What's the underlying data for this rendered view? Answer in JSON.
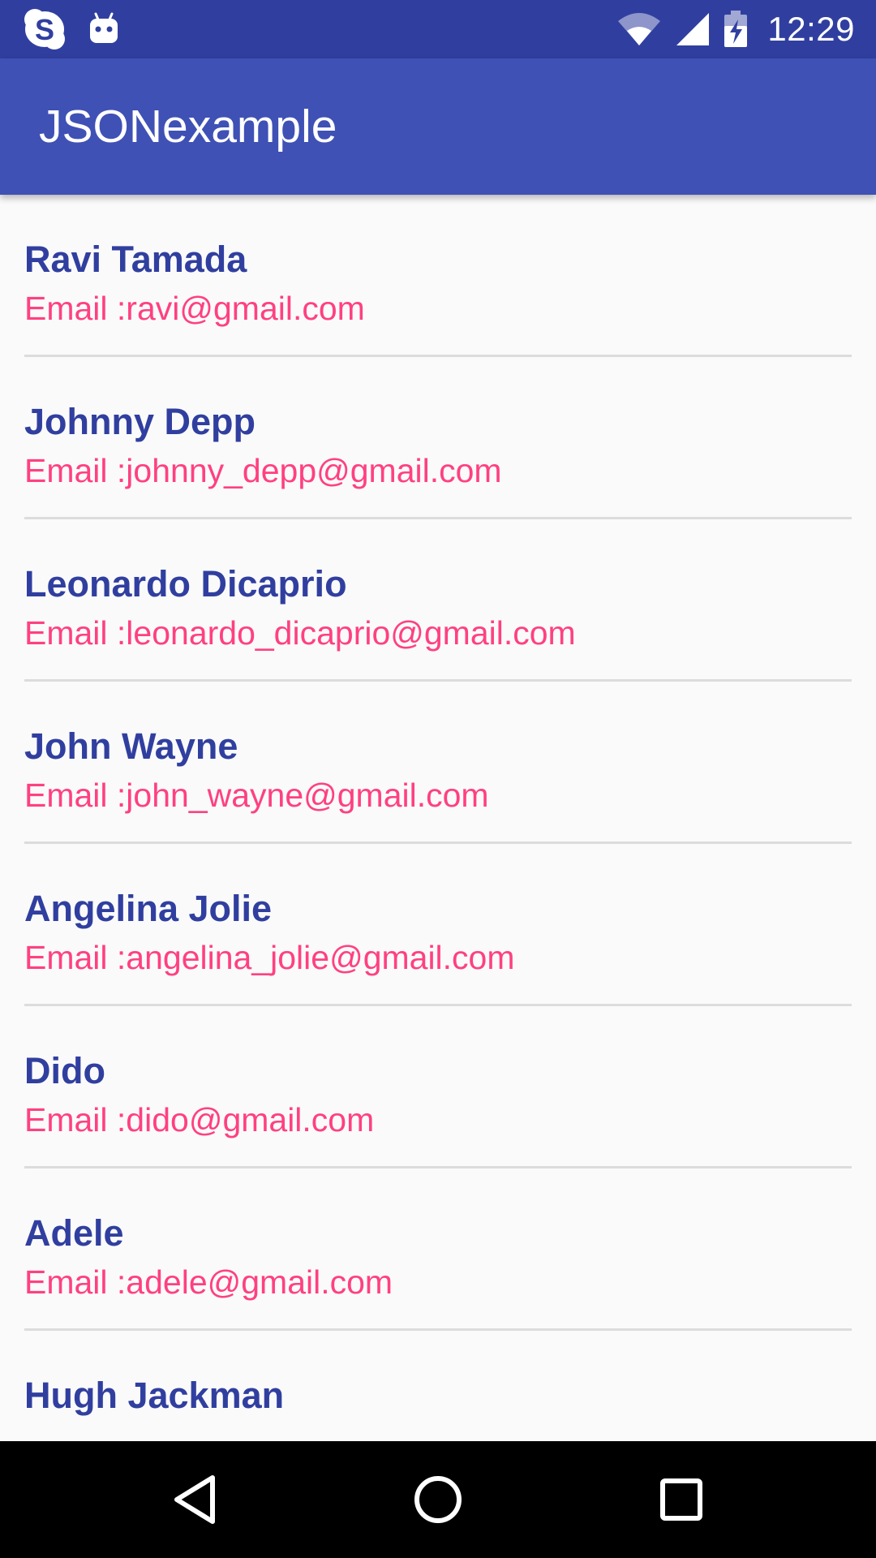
{
  "status_bar": {
    "left_icons": [
      "skype-icon",
      "android-debug-icon"
    ],
    "right_icons": [
      "wifi-icon",
      "cell-signal-icon",
      "battery-charging-icon"
    ],
    "time": "12:29"
  },
  "app_bar": {
    "title": "JSONexample"
  },
  "contacts": [
    {
      "name": "Ravi Tamada",
      "email": "Email :ravi@gmail.com"
    },
    {
      "name": "Johnny Depp",
      "email": "Email :johnny_depp@gmail.com"
    },
    {
      "name": "Leonardo Dicaprio",
      "email": "Email :leonardo_dicaprio@gmail.com"
    },
    {
      "name": "John Wayne",
      "email": "Email :john_wayne@gmail.com"
    },
    {
      "name": "Angelina Jolie",
      "email": "Email :angelina_jolie@gmail.com"
    },
    {
      "name": "Dido",
      "email": "Email :dido@gmail.com"
    },
    {
      "name": "Adele",
      "email": "Email :adele@gmail.com"
    },
    {
      "name": "Hugh Jackman",
      "email": ""
    }
  ],
  "nav_bar": {
    "buttons": [
      "back-icon",
      "home-icon",
      "recents-icon"
    ]
  },
  "colors": {
    "status_bar": "#303f9f",
    "app_bar": "#3f51b5",
    "name_text": "#303f9f",
    "email_text": "#ff4081",
    "background": "#fafafa"
  }
}
